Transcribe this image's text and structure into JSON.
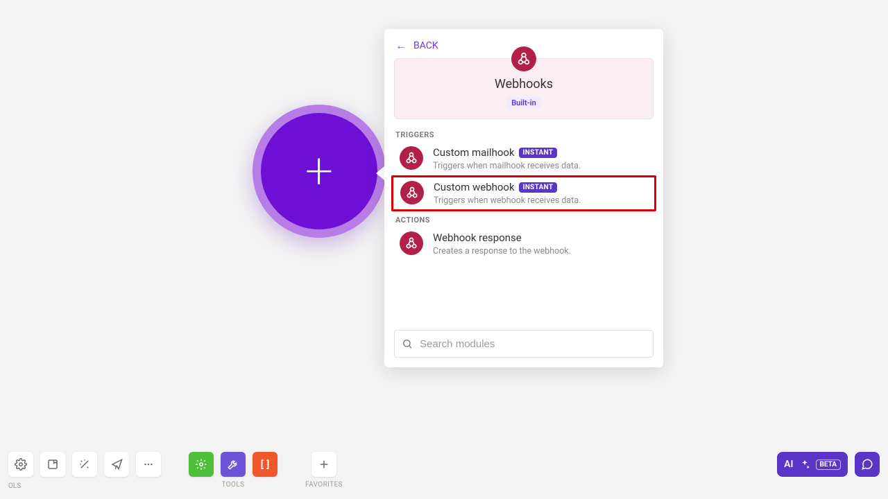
{
  "addNode": {
    "plus": "+"
  },
  "panel": {
    "back": "BACK",
    "header": {
      "title": "Webhooks",
      "tag": "Built-in"
    },
    "sections": {
      "triggers_label": "TRIGGERS",
      "actions_label": "ACTIONS"
    },
    "triggers": [
      {
        "title": "Custom mailhook",
        "badge": "INSTANT",
        "desc": "Triggers when mailhook receives data."
      },
      {
        "title": "Custom webhook",
        "badge": "INSTANT",
        "desc": "Triggers when webhook receives data."
      }
    ],
    "actions": [
      {
        "title": "Webhook response",
        "desc": "Creates a response to the webhook."
      }
    ],
    "search_placeholder": "Search modules"
  },
  "bottom": {
    "ols": "OLS",
    "tools_label": "TOOLS",
    "favorites_label": "FAVORITES",
    "ai_label": "AI",
    "beta": "BETA"
  }
}
